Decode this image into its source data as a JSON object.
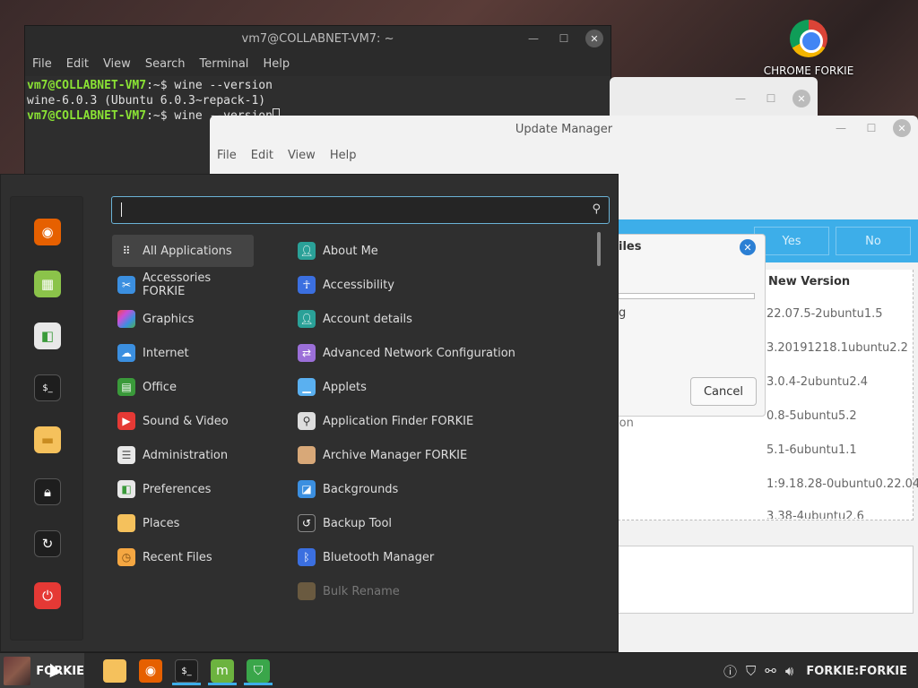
{
  "desktop": {
    "chrome_icon_label": "CHROME FORKIE"
  },
  "terminal": {
    "title": "vm7@COLLABNET-VM7: ~",
    "menu": [
      "File",
      "Edit",
      "View",
      "Search",
      "Terminal",
      "Help"
    ],
    "lines": [
      {
        "prompt": "vm7@COLLABNET-VM7",
        "rest": ":~$ wine --version"
      },
      {
        "prompt": "",
        "rest": "wine-6.0.3 (Ubuntu 6.0.3~repack-1)"
      },
      {
        "prompt": "vm7@COLLABNET-VM7",
        "rest": ":~$ wine --version"
      }
    ],
    "min": "—",
    "max": "☐",
    "close": "✕"
  },
  "update_manager": {
    "title": "Update Manager",
    "menu": [
      "File",
      "Edit",
      "View",
      "Help"
    ],
    "yes_label": "Yes",
    "no_label": "No",
    "column_new_version": "New Version",
    "versions": [
      "22.07.5-2ubuntu1.5",
      "3.20191218.1ubuntu2.2",
      "3.0.4-2ubuntu2.4",
      "0.8-5ubuntu5.2",
      "5.1-6ubuntu1.1",
      "1:9.18.28-0ubuntu0.22.04.",
      "3.38-4ubuntu2.6"
    ]
  },
  "dialog": {
    "title_fragment": "iles",
    "text_fragment": "g",
    "cancel_label": "Cancel",
    "stray_fragment": "ion"
  },
  "start_menu": {
    "search_placeholder": "",
    "favorites": [
      {
        "icon": "firefox-icon",
        "color": "#e66000"
      },
      {
        "icon": "software-manager-icon",
        "color": "#8bc34a"
      },
      {
        "icon": "settings-toggle-icon",
        "color": "#e8e8e8"
      },
      {
        "icon": "terminal-icon",
        "color": "#1e1e1e"
      },
      {
        "icon": "folder-icon",
        "color": "#f5c15c"
      },
      {
        "icon": "lock-icon",
        "color": "#1e1e1e"
      },
      {
        "icon": "logout-icon",
        "color": "#1e1e1e"
      },
      {
        "icon": "power-icon",
        "color": "#e53935"
      }
    ],
    "categories": [
      {
        "label": "All Applications",
        "icon": "grid-icon",
        "color": "#444"
      },
      {
        "label": "Accessories FORKIE",
        "icon": "scissors-icon",
        "color": "#3b8fe0"
      },
      {
        "label": "Graphics",
        "icon": "graphics-icon",
        "color": "#c84fd8"
      },
      {
        "label": "Internet",
        "icon": "cloud-icon",
        "color": "#3b8fe0"
      },
      {
        "label": "Office",
        "icon": "office-icon",
        "color": "#3a9a3a"
      },
      {
        "label": "Sound & Video",
        "icon": "play-icon",
        "color": "#e53935"
      },
      {
        "label": "Administration",
        "icon": "admin-icon",
        "color": "#e8e8e8"
      },
      {
        "label": "Preferences",
        "icon": "preferences-icon",
        "color": "#e8e8e8"
      },
      {
        "label": "Places",
        "icon": "folder-icon",
        "color": "#f5c15c"
      },
      {
        "label": "Recent Files",
        "icon": "recent-folder-icon",
        "color": "#f5a742"
      }
    ],
    "apps": [
      {
        "label": "About Me",
        "icon": "person-icon",
        "color": "#2aa198"
      },
      {
        "label": "Accessibility",
        "icon": "accessibility-icon",
        "color": "#3b6fe0"
      },
      {
        "label": "Account details",
        "icon": "account-icon",
        "color": "#2aa198"
      },
      {
        "label": "Advanced Network Configuration",
        "icon": "network-icon",
        "color": "#9b6fd8"
      },
      {
        "label": "Applets",
        "icon": "applets-icon",
        "color": "#5ab0f0"
      },
      {
        "label": "Application Finder FORKIE",
        "icon": "magnifier-icon",
        "color": "#dddddd"
      },
      {
        "label": "Archive Manager FORKIE",
        "icon": "archive-icon",
        "color": "#d8a878"
      },
      {
        "label": "Backgrounds",
        "icon": "backgrounds-icon",
        "color": "#3b8fe0"
      },
      {
        "label": "Backup Tool",
        "icon": "backup-icon",
        "color": "#2b2b2b"
      },
      {
        "label": "Bluetooth Manager",
        "icon": "bluetooth-icon",
        "color": "#3b6fe0"
      },
      {
        "label": "Bulk Rename",
        "icon": "bulk-rename-icon",
        "color": "#6a5a40"
      }
    ]
  },
  "taskbar": {
    "menu_label": "FORKIE",
    "apps": [
      {
        "icon": "files-icon",
        "color": "#f5c15c"
      },
      {
        "icon": "firefox-icon",
        "color": "#e66000"
      },
      {
        "icon": "terminal-icon",
        "color": "#1e1e1e"
      },
      {
        "icon": "mint-update-icon",
        "color": "#6cb33f"
      },
      {
        "icon": "shield-icon",
        "color": "#3aa64a"
      }
    ],
    "tray_user": "FORKIE:FORKIE"
  }
}
